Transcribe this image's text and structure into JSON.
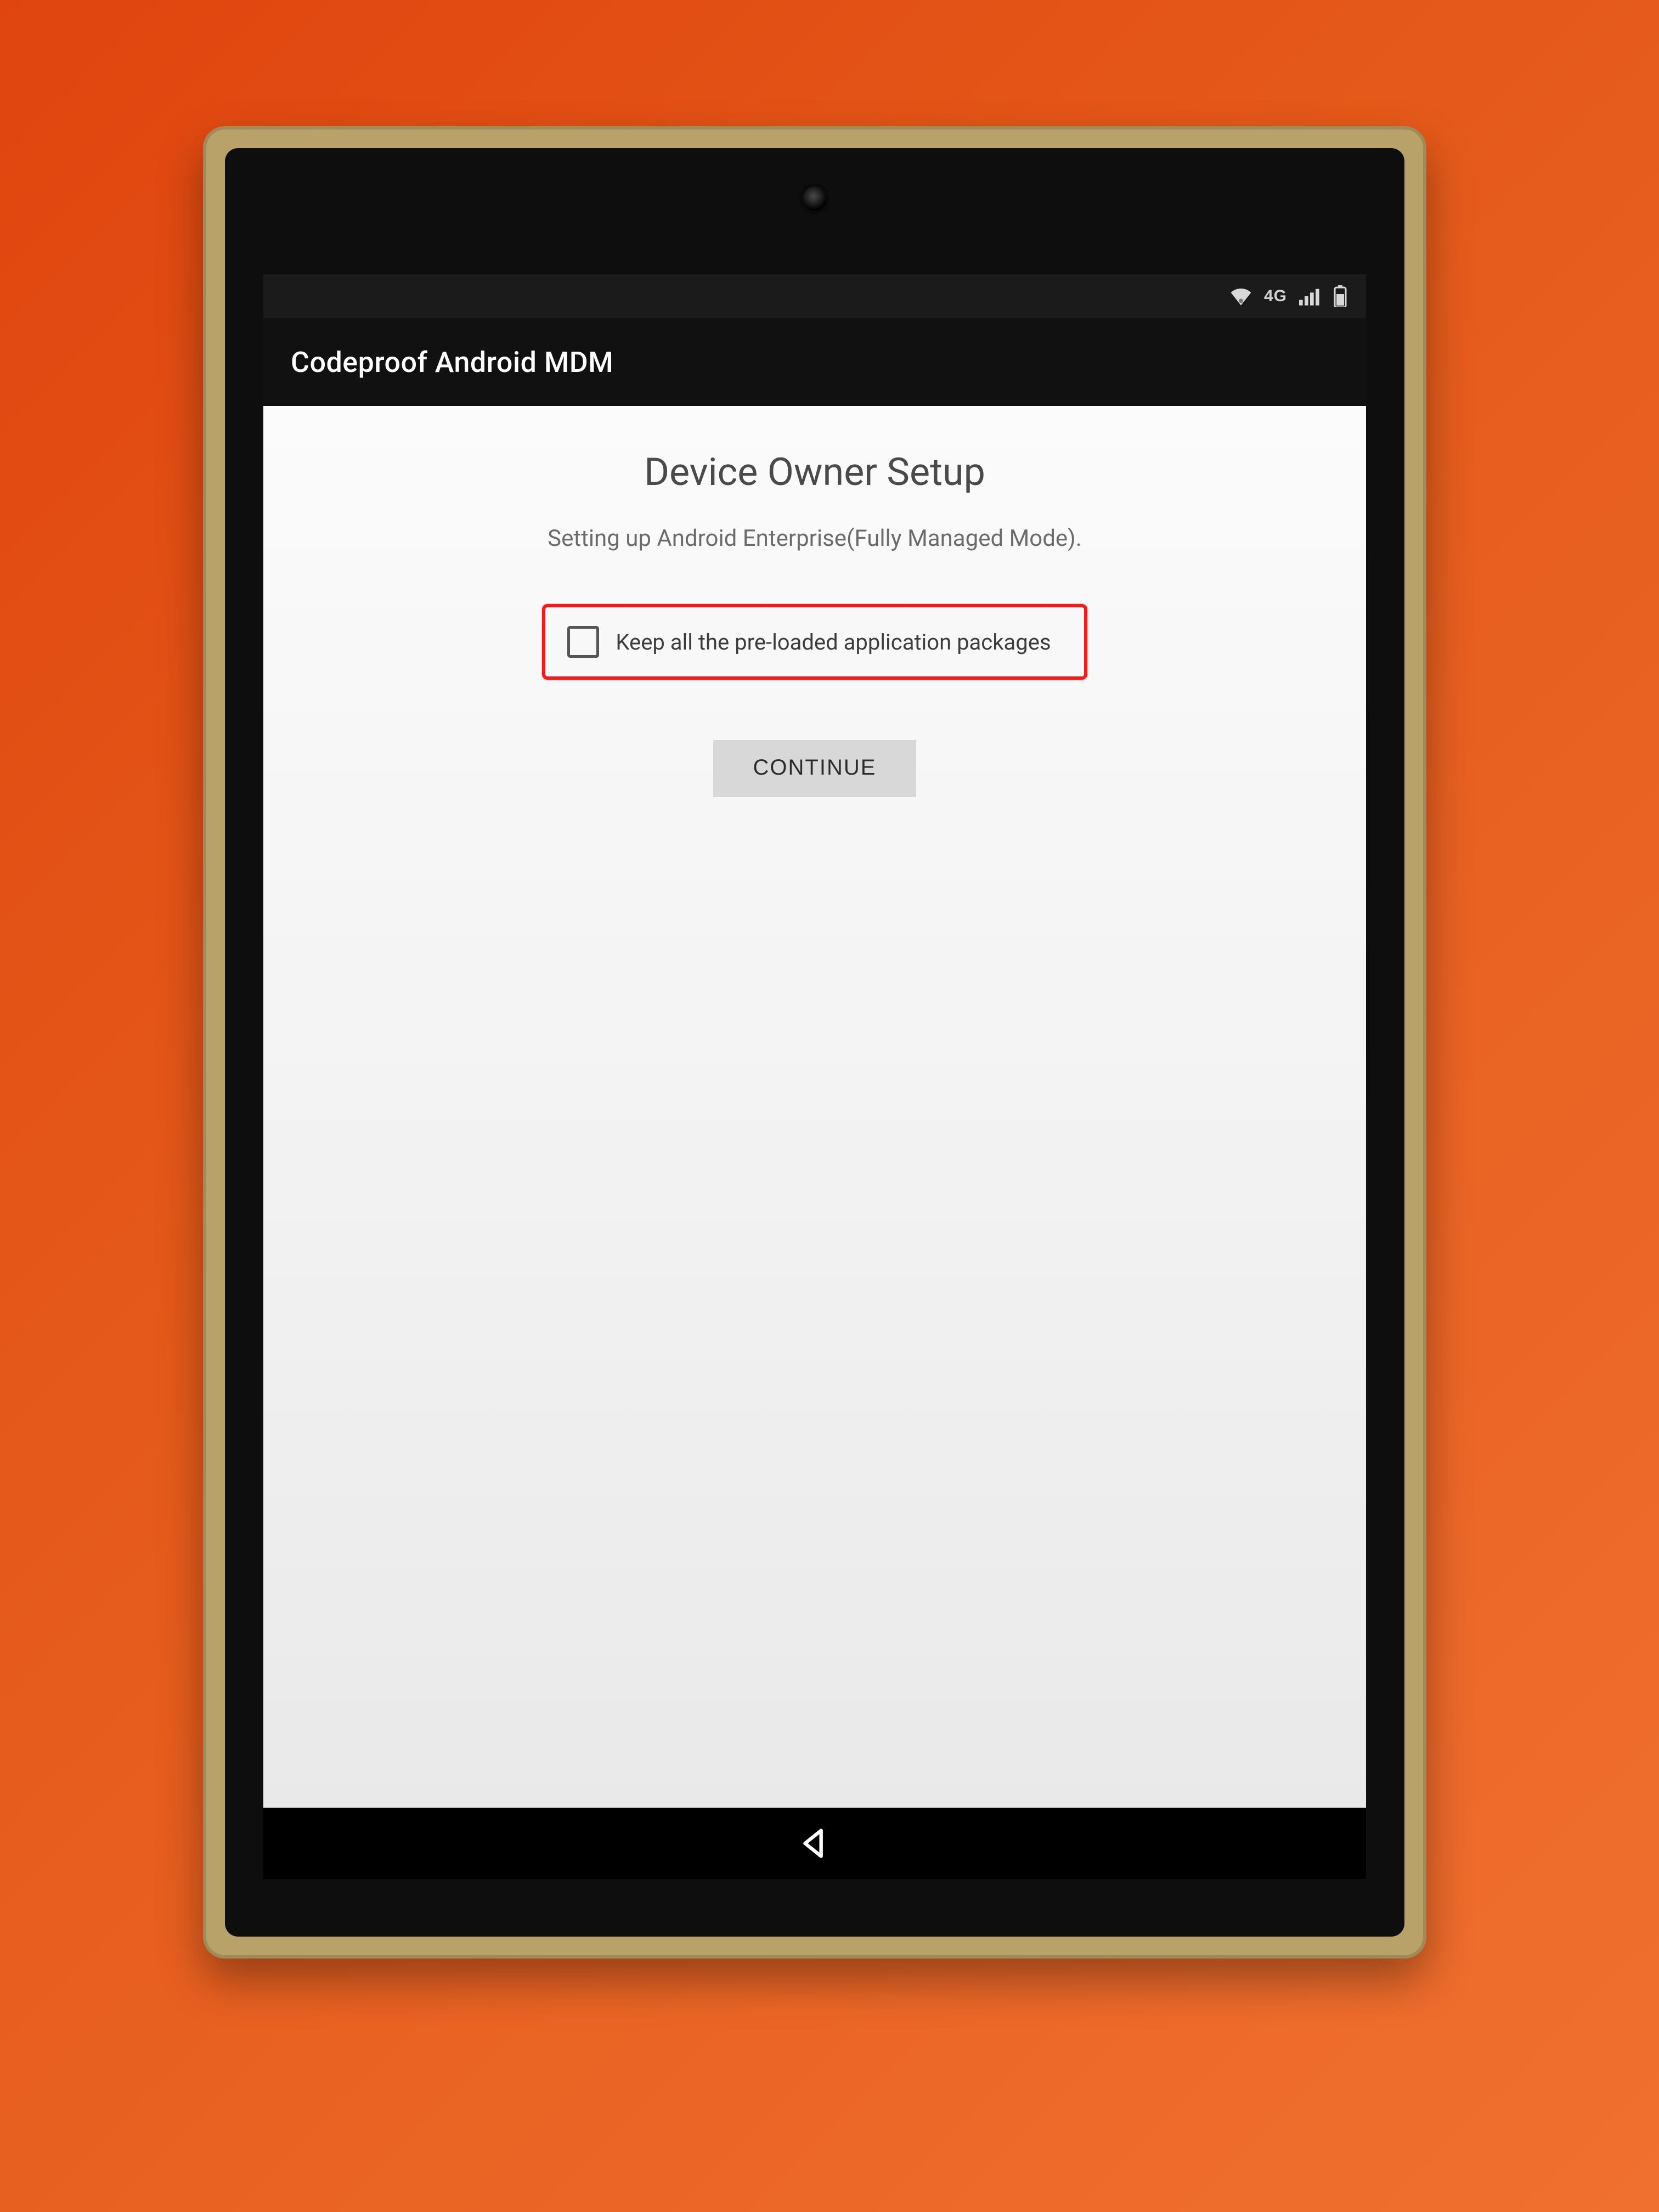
{
  "statusbar": {
    "network_label": "4G"
  },
  "appbar": {
    "title": "Codeproof Android MDM"
  },
  "page": {
    "title": "Device Owner Setup",
    "subtitle": "Setting up Android Enterprise(Fully Managed Mode).",
    "checkbox_label": "Keep all the pre-loaded application packages",
    "checkbox_checked": false,
    "continue_label": "CONTINUE"
  },
  "highlight": {
    "color": "#f21b1b"
  }
}
